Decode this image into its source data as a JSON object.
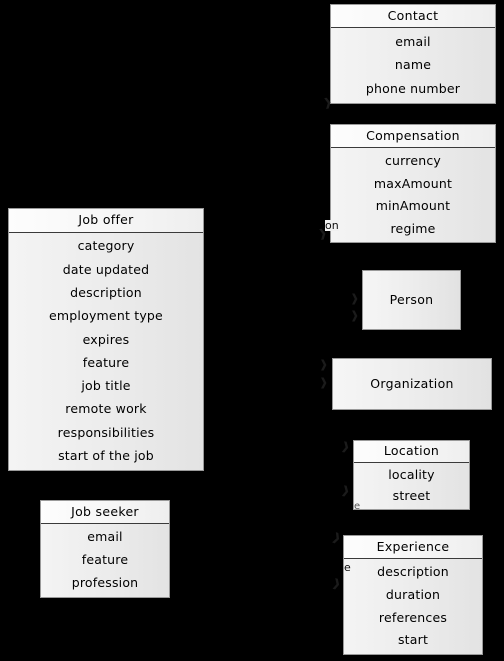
{
  "diagram": {
    "type": "uml-class-diagram",
    "background_color": "#000000",
    "box_fill_color": "#ededed",
    "box_border_color": "#9a9a9a",
    "text_color": "#000000",
    "classes": [
      {
        "id": "contact",
        "name": "Contact",
        "attributes": [
          "email",
          "name",
          "phone number"
        ]
      },
      {
        "id": "compensation",
        "name": "Compensation",
        "attributes": [
          "currency",
          "maxAmount",
          "minAmount",
          "regime"
        ]
      },
      {
        "id": "job-offer",
        "name": "Job offer",
        "attributes": [
          "category",
          "date updated",
          "description",
          "employment type",
          "expires",
          "feature",
          "job title",
          "remote work",
          "responsibilities",
          "start of the job"
        ]
      },
      {
        "id": "person",
        "name": "Person",
        "attributes": []
      },
      {
        "id": "organization",
        "name": "Organization",
        "attributes": []
      },
      {
        "id": "location",
        "name": "Location",
        "attributes": [
          "locality",
          "street"
        ]
      },
      {
        "id": "experience",
        "name": "Experience",
        "attributes": [
          "description",
          "duration",
          "references",
          "start"
        ]
      },
      {
        "id": "job-seeker",
        "name": "Job seeker",
        "attributes": [
          "email",
          "feature",
          "profession"
        ]
      }
    ],
    "edge_labels": [
      {
        "id": "label-compensation",
        "text": "on"
      },
      {
        "id": "label-location",
        "text": "e"
      },
      {
        "id": "label-experience",
        "text": "e"
      }
    ],
    "arrow_glyph": "❱"
  }
}
